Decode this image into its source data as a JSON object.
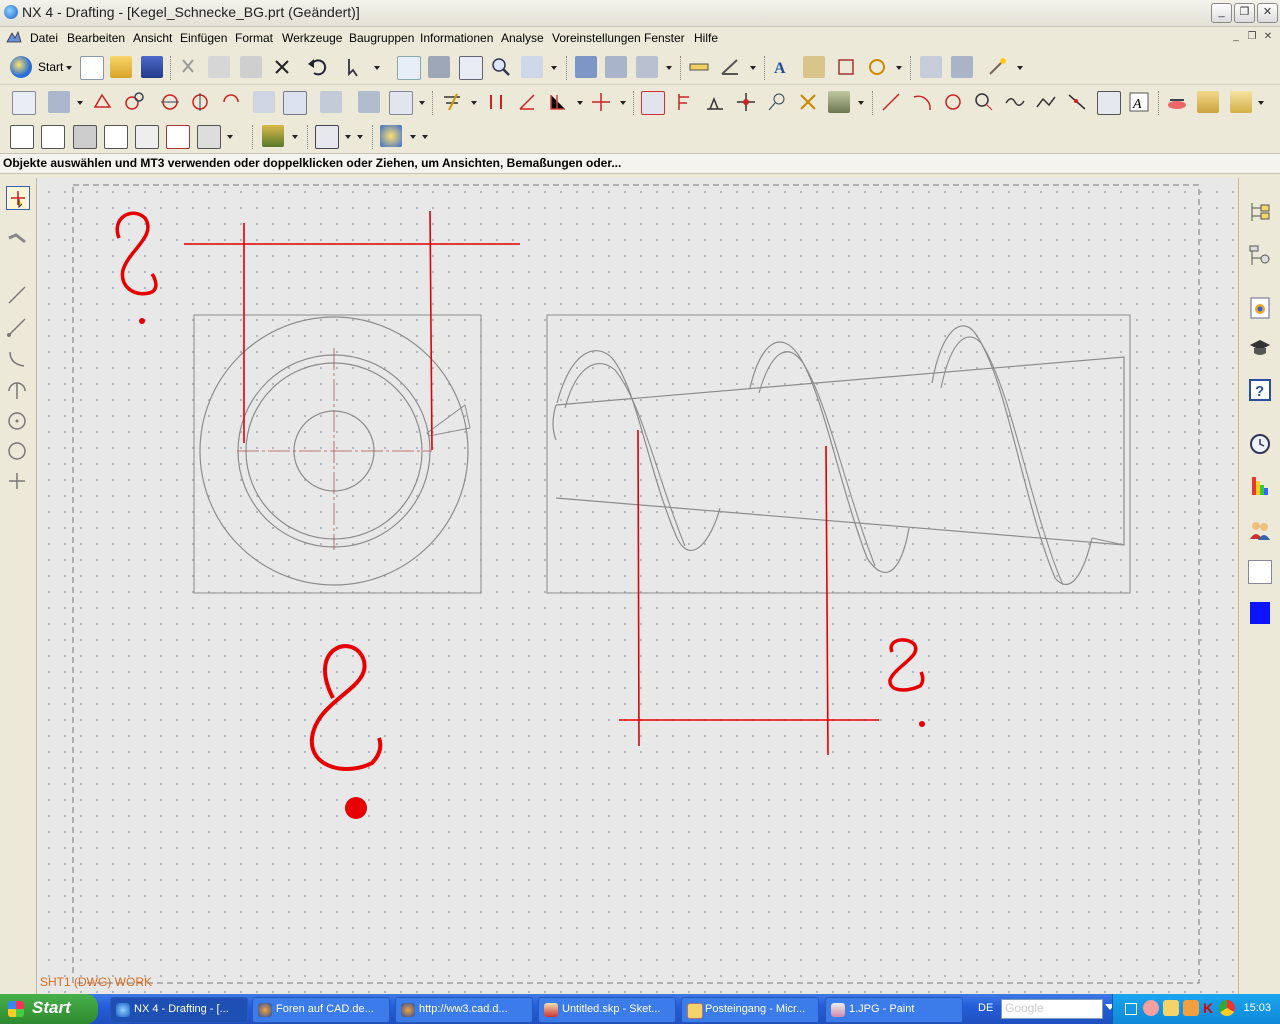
{
  "window": {
    "title": "NX 4 - Drafting - [Kegel_Schnecke_BG.prt (Geändert)]",
    "controls": [
      "minimize-icon",
      "restore-icon",
      "close-icon"
    ]
  },
  "menu": {
    "items": [
      {
        "label": "Datei"
      },
      {
        "label": "Bearbeiten"
      },
      {
        "label": "Ansicht"
      },
      {
        "label": "Einfügen"
      },
      {
        "label": "Format"
      },
      {
        "label": "Werkzeuge"
      },
      {
        "label": "Baugruppen"
      },
      {
        "label": "Informationen"
      },
      {
        "label": "Analyse"
      },
      {
        "label": "Voreinstellungen"
      },
      {
        "label": "Fenster"
      },
      {
        "label": "Hilfe"
      }
    ]
  },
  "toolbar": {
    "start_label": "Start"
  },
  "cue_line": "Objekte auswählen und MT3 verwenden oder doppelklicken oder Ziehen, um Ansichten, Bemaßungen oder...",
  "sheet_status": "SHT1 (DWG) WORK",
  "taskbar": {
    "start_label": "Start",
    "tasks": [
      {
        "label": "NX 4 - Drafting - [...",
        "active": true
      },
      {
        "label": "Foren auf CAD.de...",
        "active": false
      },
      {
        "label": "http://ww3.cad.d...",
        "active": false
      },
      {
        "label": "Untitled.skp - Sket...",
        "active": false
      },
      {
        "label": "Posteingang - Micr...",
        "active": false
      },
      {
        "label": "1.JPG - Paint",
        "active": false
      }
    ],
    "language": "DE",
    "search_placeholder": "Google",
    "clock": "15:03"
  },
  "colors": {
    "annotation_red": "#e60000",
    "drawing_gray": "#8c8c8c",
    "sheet_label": "#e06a1a",
    "taskbar_blue": "#245edb"
  }
}
